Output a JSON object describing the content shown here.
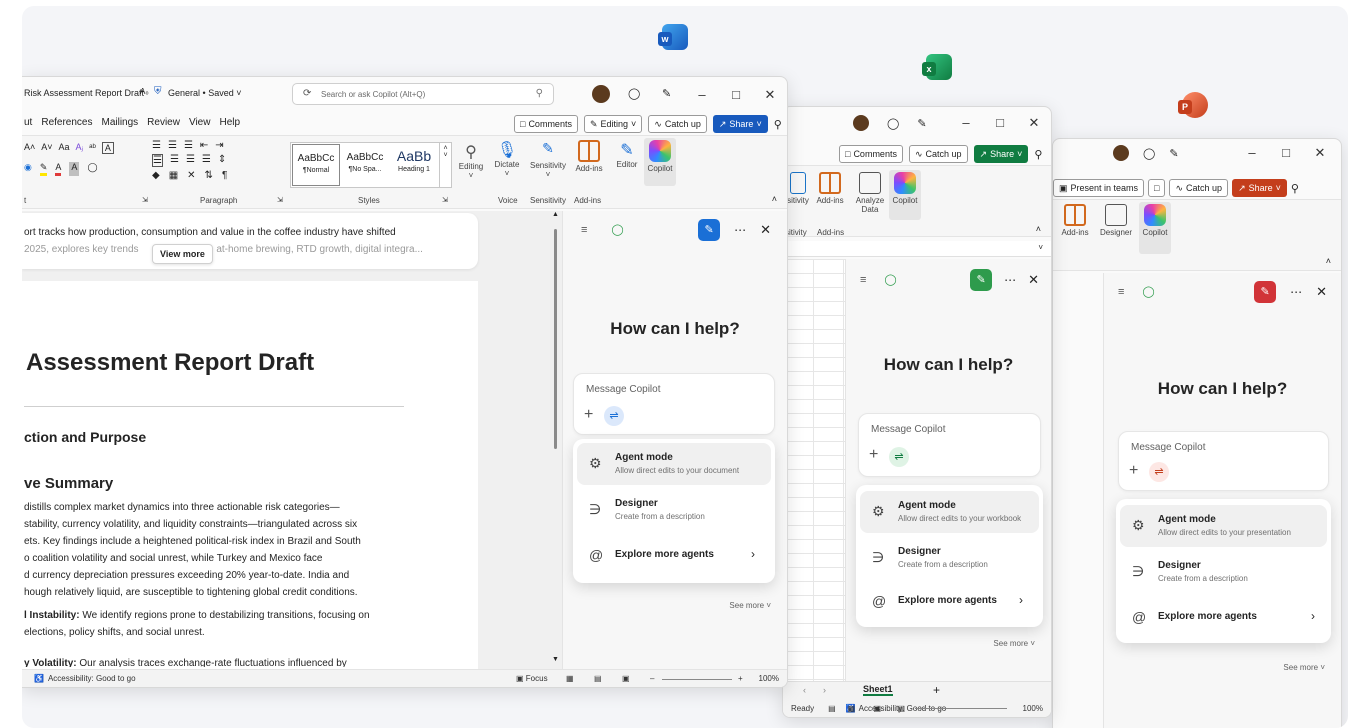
{
  "colors": {
    "word_blue": "#185abd",
    "excel_green": "#107c41",
    "ppt_red": "#c43e1c",
    "copilot_new_word": "#1a6fd6"
  },
  "app_icons": [
    "word-icon",
    "excel-icon",
    "powerpoint-icon"
  ],
  "word": {
    "title": "Risk Assessment Report Draft",
    "sensitivity": "General",
    "saved": "Saved",
    "search_placeholder": "Search or ask Copilot (Alt+Q)",
    "tabs": [
      "ut",
      "References",
      "Mailings",
      "Review",
      "View",
      "Help"
    ],
    "comments": "Comments",
    "editing": "Editing",
    "catch_up": "Catch up",
    "share": "Share",
    "font_row1": [
      "A˄",
      "A˅",
      "Aa",
      "Aⱼ",
      "ᵃᵇ",
      "A"
    ],
    "styles": [
      {
        "preview": "AaBbCc",
        "name": "¶Normal"
      },
      {
        "preview": "AaBbCc",
        "name": "¶No Spa..."
      },
      {
        "preview": "AaBb",
        "name": "Heading 1"
      }
    ],
    "groups": {
      "font": "t",
      "paragraph": "Paragraph",
      "styles": "Styles",
      "voice": "Voice",
      "sensitivity": "Sensitivity",
      "addins": "Add-ins"
    },
    "buttons": {
      "editing": "Editing",
      "dictate": "Dictate",
      "sensitivity": "Sensitivity",
      "addins": "Add-ins",
      "editor": "Editor",
      "copilot": "Copilot"
    },
    "summary_line1": "ort tracks how production, consumption and value in the coffee industry have shifted",
    "summary_line2a": "2025, explores key trends",
    "summary_line2b": "y, at-home brewing, RTD growth, digital integra...",
    "view_more": "View more",
    "doc_title": "Assessment Report Draft",
    "heading1": "ction and Purpose",
    "heading2": "ve Summary",
    "body_lines": [
      "distills complex market dynamics into three actionable risk categories—",
      "stability, currency volatility, and liquidity constraints—triangulated across six",
      "ets. Key findings include a heightened political-risk index in Brazil and South",
      "o coalition volatility and social unrest, while Turkey and Mexico face",
      "d currency depreciation pressures exceeding 20% year-to-date. India and",
      "hough relatively liquid, are susceptible to tightening global credit conditions."
    ],
    "bullet1_bold": "l Instability:",
    "bullet1_text": " We identify regions prone to destabilizing transitions, focusing on",
    "bullet1_line2": "elections, policy shifts, and social unrest.",
    "bullet2_bold": "y Volatility:",
    "bullet2_text": " Our analysis traces exchange-rate fluctuations influenced by",
    "status_access": "Accessibility: Good to go",
    "status_focus": "Focus",
    "zoom": "100%",
    "copilot": {
      "heading": "How can I help?",
      "placeholder": "Message Copilot",
      "agent_title": "Agent mode",
      "agent_sub": "Allow direct edits to your document",
      "designer_title": "Designer",
      "designer_sub": "Create from a description",
      "explore": "Explore more agents",
      "see_more": "See more"
    }
  },
  "excel": {
    "comments": "Comments",
    "catch_up": "Catch up",
    "share": "Share",
    "ribbon_labels": [
      "sitivity",
      "Add-ins",
      "Analyze Data",
      "Copilot"
    ],
    "group_labels": [
      "sitivity",
      "Add-ins"
    ],
    "sheet_tab": "Sheet1",
    "status_ready": "Ready",
    "status_access": "Accessibility: Good to go",
    "zoom": "100%",
    "copilot": {
      "heading": "How can I help?",
      "placeholder": "Message Copilot",
      "agent_title": "Agent mode",
      "agent_sub": "Allow direct edits to your workbook",
      "designer_title": "Designer",
      "designer_sub": "Create from a description",
      "explore": "Explore more agents",
      "see_more": "See more"
    }
  },
  "ppt": {
    "present": "Present in teams",
    "catch_up": "Catch up",
    "share": "Share",
    "ribbon_labels": [
      "Add-ins",
      "Designer",
      "Copilot"
    ],
    "copilot": {
      "heading": "How can I help?",
      "placeholder": "Message Copilot",
      "agent_title": "Agent mode",
      "agent_sub": "Allow direct edits to your presentation",
      "designer_title": "Designer",
      "designer_sub": "Create from a description",
      "explore": "Explore more agents",
      "see_more": "See more"
    }
  }
}
